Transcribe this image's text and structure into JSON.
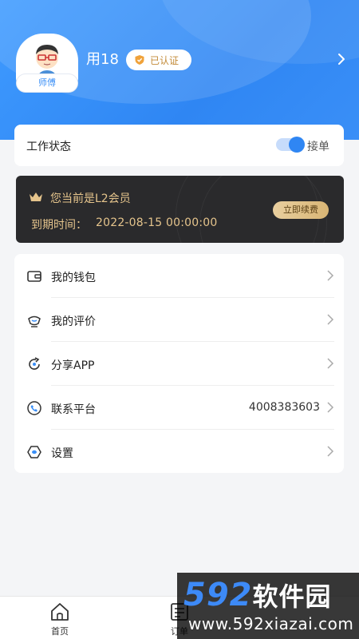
{
  "header": {
    "user_name": "用18",
    "avatar_role": "师傅",
    "verified_label": "已认证"
  },
  "work_status": {
    "label": "工作状态",
    "toggle_label": "接单",
    "toggle_on": true
  },
  "member": {
    "level_text": "您当前是L2会员",
    "expire_label": "到期时间：",
    "expire_value": "2022-08-15 00:00:00",
    "renew_label": "立即续费"
  },
  "menu": {
    "items": [
      {
        "label": "我的钱包",
        "icon": "wallet-icon",
        "value": ""
      },
      {
        "label": "我的评价",
        "icon": "review-icon",
        "value": ""
      },
      {
        "label": "分享APP",
        "icon": "share-icon",
        "value": ""
      },
      {
        "label": "联系平台",
        "icon": "phone-icon",
        "value": "4008383603"
      },
      {
        "label": "设置",
        "icon": "settings-icon",
        "value": ""
      }
    ]
  },
  "bottom_nav": {
    "home_label": "首页",
    "orders_label": "订单"
  },
  "watermark": {
    "brand_num": "592",
    "brand_cn": "软件园",
    "url": "www.592xiazai.com"
  },
  "colors": {
    "primary": "#2f86f3",
    "gold": "#e5c48c",
    "member_bg": "#2a2a2c"
  }
}
